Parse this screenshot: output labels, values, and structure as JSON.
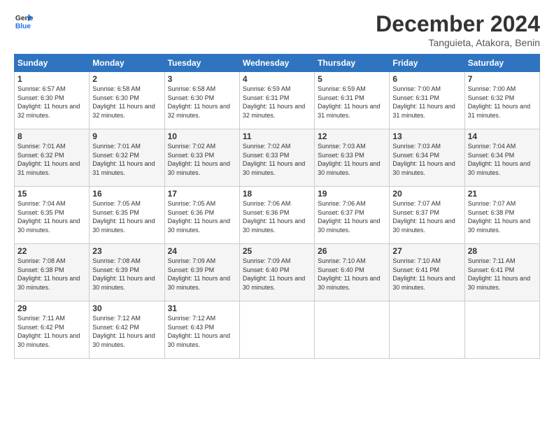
{
  "header": {
    "logo_line1": "General",
    "logo_line2": "Blue",
    "month": "December 2024",
    "location": "Tanguieta, Atakora, Benin"
  },
  "weekdays": [
    "Sunday",
    "Monday",
    "Tuesday",
    "Wednesday",
    "Thursday",
    "Friday",
    "Saturday"
  ],
  "weeks": [
    [
      {
        "day": "1",
        "sunrise": "6:57 AM",
        "sunset": "6:30 PM",
        "daylight": "11 hours and 32 minutes."
      },
      {
        "day": "2",
        "sunrise": "6:58 AM",
        "sunset": "6:30 PM",
        "daylight": "11 hours and 32 minutes."
      },
      {
        "day": "3",
        "sunrise": "6:58 AM",
        "sunset": "6:30 PM",
        "daylight": "11 hours and 32 minutes."
      },
      {
        "day": "4",
        "sunrise": "6:59 AM",
        "sunset": "6:31 PM",
        "daylight": "11 hours and 32 minutes."
      },
      {
        "day": "5",
        "sunrise": "6:59 AM",
        "sunset": "6:31 PM",
        "daylight": "11 hours and 31 minutes."
      },
      {
        "day": "6",
        "sunrise": "7:00 AM",
        "sunset": "6:31 PM",
        "daylight": "11 hours and 31 minutes."
      },
      {
        "day": "7",
        "sunrise": "7:00 AM",
        "sunset": "6:32 PM",
        "daylight": "11 hours and 31 minutes."
      }
    ],
    [
      {
        "day": "8",
        "sunrise": "7:01 AM",
        "sunset": "6:32 PM",
        "daylight": "11 hours and 31 minutes."
      },
      {
        "day": "9",
        "sunrise": "7:01 AM",
        "sunset": "6:32 PM",
        "daylight": "11 hours and 31 minutes."
      },
      {
        "day": "10",
        "sunrise": "7:02 AM",
        "sunset": "6:33 PM",
        "daylight": "11 hours and 30 minutes."
      },
      {
        "day": "11",
        "sunrise": "7:02 AM",
        "sunset": "6:33 PM",
        "daylight": "11 hours and 30 minutes."
      },
      {
        "day": "12",
        "sunrise": "7:03 AM",
        "sunset": "6:33 PM",
        "daylight": "11 hours and 30 minutes."
      },
      {
        "day": "13",
        "sunrise": "7:03 AM",
        "sunset": "6:34 PM",
        "daylight": "11 hours and 30 minutes."
      },
      {
        "day": "14",
        "sunrise": "7:04 AM",
        "sunset": "6:34 PM",
        "daylight": "11 hours and 30 minutes."
      }
    ],
    [
      {
        "day": "15",
        "sunrise": "7:04 AM",
        "sunset": "6:35 PM",
        "daylight": "11 hours and 30 minutes."
      },
      {
        "day": "16",
        "sunrise": "7:05 AM",
        "sunset": "6:35 PM",
        "daylight": "11 hours and 30 minutes."
      },
      {
        "day": "17",
        "sunrise": "7:05 AM",
        "sunset": "6:36 PM",
        "daylight": "11 hours and 30 minutes."
      },
      {
        "day": "18",
        "sunrise": "7:06 AM",
        "sunset": "6:36 PM",
        "daylight": "11 hours and 30 minutes."
      },
      {
        "day": "19",
        "sunrise": "7:06 AM",
        "sunset": "6:37 PM",
        "daylight": "11 hours and 30 minutes."
      },
      {
        "day": "20",
        "sunrise": "7:07 AM",
        "sunset": "6:37 PM",
        "daylight": "11 hours and 30 minutes."
      },
      {
        "day": "21",
        "sunrise": "7:07 AM",
        "sunset": "6:38 PM",
        "daylight": "11 hours and 30 minutes."
      }
    ],
    [
      {
        "day": "22",
        "sunrise": "7:08 AM",
        "sunset": "6:38 PM",
        "daylight": "11 hours and 30 minutes."
      },
      {
        "day": "23",
        "sunrise": "7:08 AM",
        "sunset": "6:39 PM",
        "daylight": "11 hours and 30 minutes."
      },
      {
        "day": "24",
        "sunrise": "7:09 AM",
        "sunset": "6:39 PM",
        "daylight": "11 hours and 30 minutes."
      },
      {
        "day": "25",
        "sunrise": "7:09 AM",
        "sunset": "6:40 PM",
        "daylight": "11 hours and 30 minutes."
      },
      {
        "day": "26",
        "sunrise": "7:10 AM",
        "sunset": "6:40 PM",
        "daylight": "11 hours and 30 minutes."
      },
      {
        "day": "27",
        "sunrise": "7:10 AM",
        "sunset": "6:41 PM",
        "daylight": "11 hours and 30 minutes."
      },
      {
        "day": "28",
        "sunrise": "7:11 AM",
        "sunset": "6:41 PM",
        "daylight": "11 hours and 30 minutes."
      }
    ],
    [
      {
        "day": "29",
        "sunrise": "7:11 AM",
        "sunset": "6:42 PM",
        "daylight": "11 hours and 30 minutes."
      },
      {
        "day": "30",
        "sunrise": "7:12 AM",
        "sunset": "6:42 PM",
        "daylight": "11 hours and 30 minutes."
      },
      {
        "day": "31",
        "sunrise": "7:12 AM",
        "sunset": "6:43 PM",
        "daylight": "11 hours and 30 minutes."
      },
      null,
      null,
      null,
      null
    ]
  ]
}
